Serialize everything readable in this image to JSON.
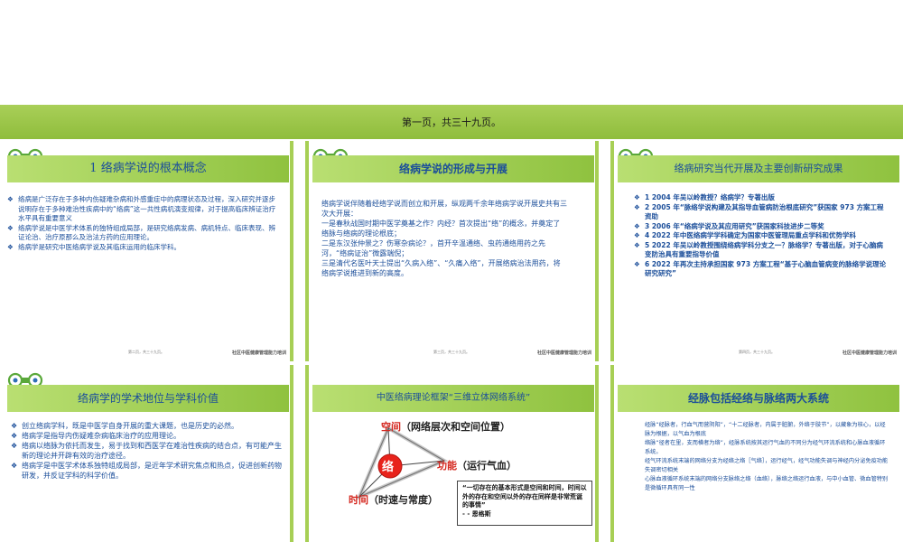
{
  "banner_text": "第一页，共三十九页。",
  "footer_org": "社区中医健康管理能力培训",
  "slides": [
    {
      "title": "1 络病学说的根本概念",
      "bullets": [
        "络病是广泛存在于多种内伤疑难杂病和外感重症中的病理状态及过程，深入研究并逐步说明存在于多种难治性疾病中的“络病”这一共性病机演变规律，对于提高临床辨证治疗水平具有重要意义",
        "络病学说是中医学术体系的独特组成局部，是研究络病发病、病机特点、临床表现、辨证论治、治疗原那么及治法方药的应用理论。",
        " 络病学是研究中医络病学说及其临床运用的临床学科。"
      ],
      "footer_page": "第二页，共三十九页。"
    },
    {
      "title": "络病学说的形成与开展",
      "body": "络病学说伴随着经络学说而创立和开展，纵观两千余年络病学说开展史共有三次大开展：\n一是春秋战国时期中医学奠基之作？内经？首次提出“络”的概念，并奠定了络脉与络病的理论根底；\n二是东汉张仲景之？伤寒杂病论？，首开辛温通络、虫药通络用药之先河，“络病证治”微露端倪；\n三是清代名医叶天士提出“久病入络”、“久痛入络”，开展络病治法用药，将络病学说推进到新的高度。",
      "footer_page": "第三页，共三十九页。"
    },
    {
      "title": "络病研究当代开展及主要创新研究成果",
      "bullets": [
        "1  2004 年吴以岭教授？络病学？专著出版",
        "2  2005 年“脉络学说构建及其指导血管病防治根底研究”获国家 973 方案工程资助",
        "3  2006 年“络病学说及其应用研究”获国家科技进步二等奖",
        "4  2022 年中医络病学学科确定为国家中医管理局重点学科和优势学科",
        "5  2022 年吴以岭教授围绕络病学科分支之一？脉络学？专著出版，对于心脑病变防治具有重要指导价值",
        " 6 2022 年再次主持承担国家 973 方案工程“基于心脑血管病变的脉络学说理论研究研究”"
      ],
      "footer_page": "第四页，共三十九页。"
    },
    {
      "title": "络病学的学术地位与学科价值",
      "bullets": [
        "创立络病学科，既是中医学自身开展的重大课题，也是历史的必然。",
        "络病学是指导内伤疑难杂病临床治疗的应用理论。",
        "络病以络脉为依托而发生，易于找到和西医学在难治性疾病的结合点，有可能产生新的理论并开辟有效的治疗途径。",
        "络病学是中医学术体系独特组成局部，是近年学术研究焦点和热点，促进创新药物研发，并反证学科的科学价值。"
      ]
    },
    {
      "title": "中医络病理论框架“三维立体网络系统”",
      "space_label": "空间",
      "space_rest": "（网络层次和空间位置）",
      "function_label": "功能",
      "function_rest": "（运行气血）",
      "time_label": "时间",
      "time_rest": "（时速与常度）",
      "center": "络",
      "quote": "“一切存在的基本形式是空间和时间，时间以外的存在和空间以外的存在同样是非常荒诞的事情”\n                    - - 恩格斯"
    },
    {
      "title": "经脉包括经络与脉络两大系统",
      "body": "经脉“经脉者，行血气而营阴阳”，“十二经脉者，内属于脏腑，外络于肢节”，以藏象为核心，以经脉为根据，以气血为根底\n络脉“径者在里，支而横者为络”，经脉系统按其运行气血的不同分为经气环流系统和心脉血液循环系统。\n经气环流系统末端的网络分支为经络之络［气络］，运行经气，经气功能失调与神经内分泌免疫功能失调密切相关\n心脉血液循环系统末端的网络分支脉络之络（血络），脉络之络运行血液，与中小血管、微血管特别是微循环具有同一性"
    }
  ]
}
